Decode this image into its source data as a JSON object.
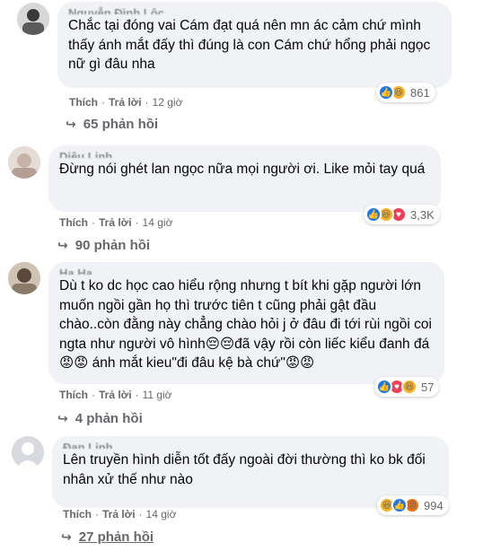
{
  "comments": [
    {
      "author": "Nguyễn Đình Lộc",
      "text": "Chắc tại đóng vai Cám đạt quá nên mn ác cảm chứ mình thấy ánh mắt đấy thì đúng là con Cám chứ hổng phải ngọc nữ gì đâu nha",
      "like_label": "Thích",
      "reply_label": "Trả lời",
      "time": "12 giờ",
      "reaction_count": "861",
      "replies_label": "65 phản hồi"
    },
    {
      "author": "Diệu Linh",
      "text": "Đừng nói ghét lan ngọc nữa mọi người ơi. Like mỏi tay quá",
      "like_label": "Thích",
      "reply_label": "Trả lời",
      "time": "14 giờ",
      "reaction_count": "3,3K",
      "replies_label": "90 phản hồi"
    },
    {
      "author": "Hạ Hạ",
      "text": "Dù t ko dc học cao hiểu rộng nhưng t bít khi gặp người lớn muốn ngồi gần họ thì trước tiên t cũng phải gật đầu chào..còn đằng này chẳng chào hỏi j ở đâu đi tới rùi ngồi coi ngta như người vô hình😔😔đã vậy rồi còn liếc kiểu đanh đá😡😡 ánh mắt kieu\"đi đâu kệ bà chứ\"😡😡",
      "like_label": "Thích",
      "reply_label": "Trả lời",
      "time": "11 giờ",
      "reaction_count": "57",
      "replies_label": "4 phản hồi"
    },
    {
      "author": "Đan Linh",
      "text": "Lên truyền hình diễn tốt đấy ngoài đời thường thì ko bk đối nhân xử thế như nào",
      "like_label": "Thích",
      "reply_label": "Trả lời",
      "time": "14 giờ",
      "reaction_count": "994",
      "replies_label": "27 phản hồi"
    }
  ],
  "icons": {
    "like": "like-icon",
    "haha": "haha-icon",
    "love": "love-icon",
    "angry": "angry-icon",
    "reply_arrow": "reply-arrow-icon"
  },
  "colors": {
    "bubble": "#f0f2f5",
    "meta_text": "#65676b",
    "like_blue": "#1877f2",
    "haha_yellow": "#f7b125",
    "love_red": "#f33e58",
    "angry_orange": "#e9710f"
  }
}
